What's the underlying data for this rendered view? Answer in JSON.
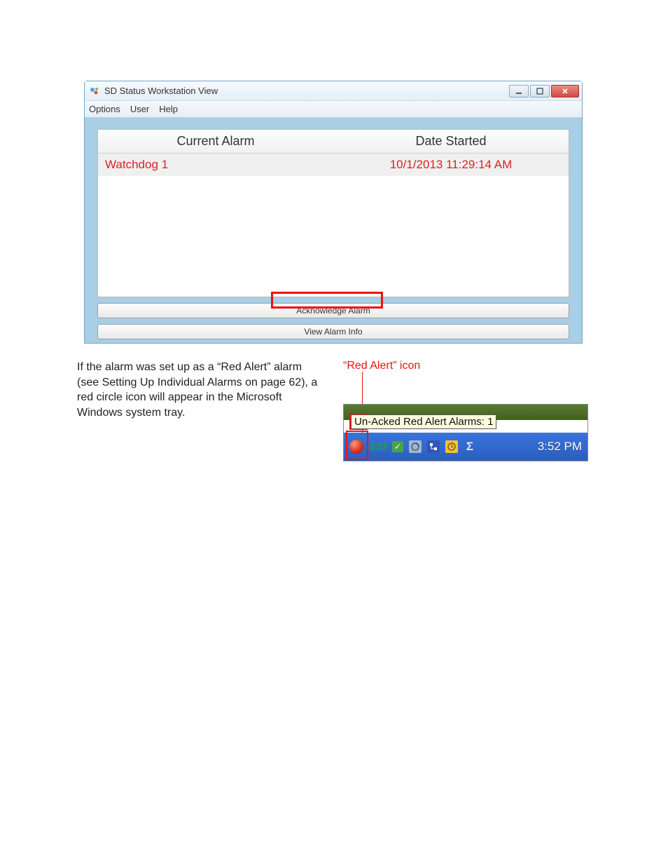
{
  "window": {
    "title": "SD Status Workstation View",
    "menu": {
      "options": "Options",
      "user": "User",
      "help": "Help"
    },
    "table": {
      "head_alarm": "Current Alarm",
      "head_date": "Date Started",
      "row0_name": "Watchdog 1",
      "row0_date": "10/1/2013 11:29:14 AM"
    },
    "ack_button": "Acknowledge Alarm",
    "view_button": "View Alarm Info"
  },
  "paragraph": "If the alarm was set up as a “Red Alert” alarm (see Setting Up Individual Alarms on page 62), a red circle icon will appear in the Microsoft Windows system tray.",
  "annotation": "“Red Alert” icon",
  "tray": {
    "tooltip": "Un-Acked Red Alert Alarms: 1",
    "ssf_label": "SSf",
    "time": "3:52 PM"
  }
}
